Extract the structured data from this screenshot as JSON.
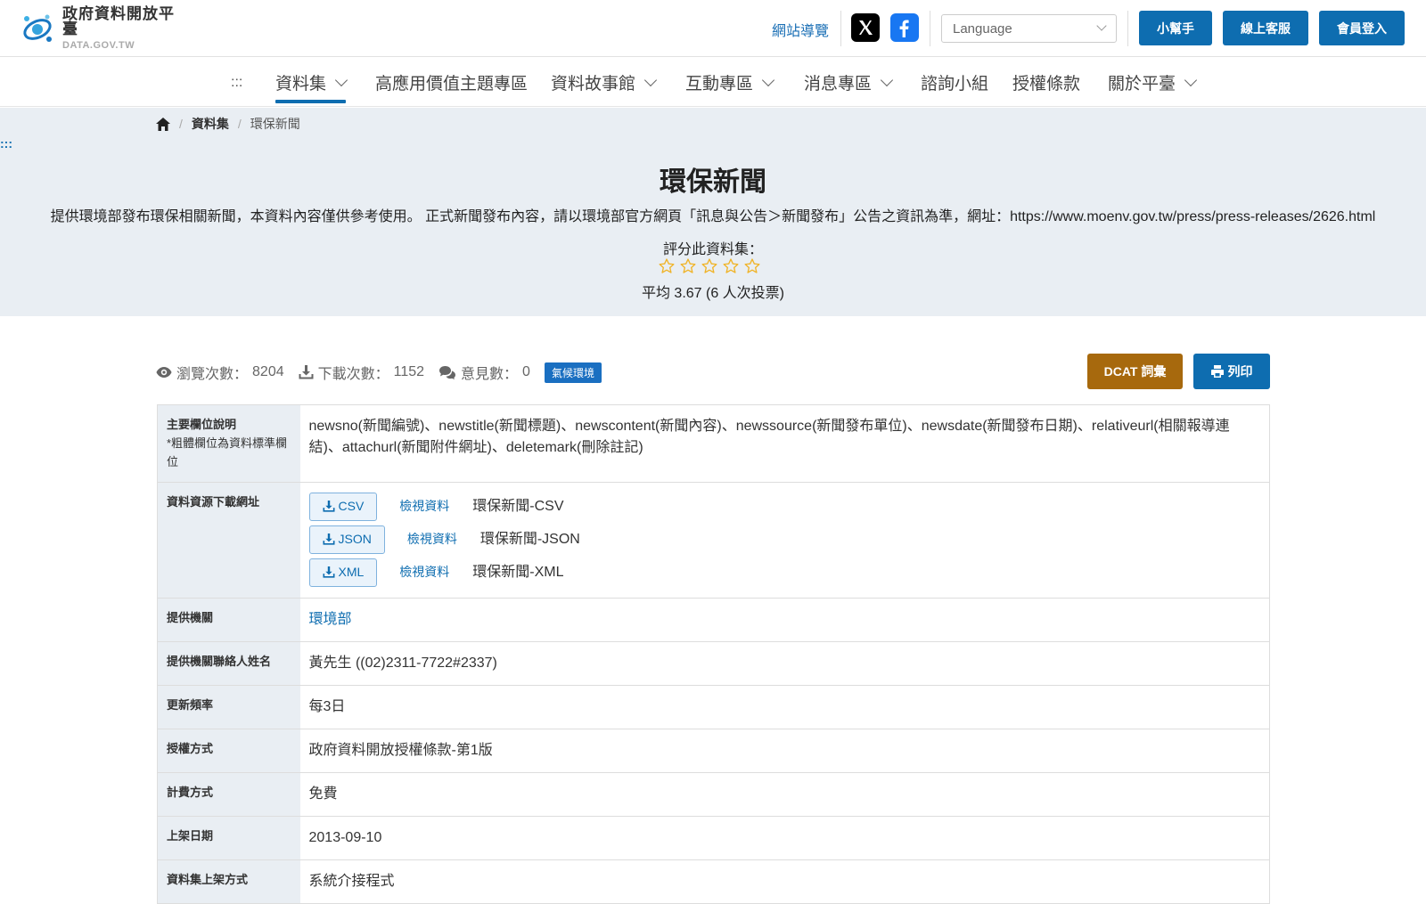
{
  "header": {
    "logo_title": "政府資料開放平臺",
    "logo_sub": "DATA.GOV.TW",
    "sitemap": "網站導覽",
    "language_placeholder": "Language",
    "buttons": {
      "helper": "小幫手",
      "support": "線上客服",
      "login": "會員登入"
    }
  },
  "nav": {
    "accesskey": ":::",
    "items": [
      {
        "label": "資料集"
      },
      {
        "label": "高應用價值主題專區"
      },
      {
        "label": "資料故事館"
      },
      {
        "label": "互動專區"
      },
      {
        "label": "消息專區"
      },
      {
        "label": "諮詢小組"
      },
      {
        "label": "授權條款"
      },
      {
        "label": "關於平臺"
      }
    ]
  },
  "breadcrumb": {
    "level1": "資料集",
    "level2": "環保新聞"
  },
  "hero": {
    "accesskey": ":::",
    "title": "環保新聞",
    "description": "提供環境部發布環保相關新聞，本資料內容僅供參考使用。 正式新聞發布內容，請以環境部官方網頁「訊息與公告＞新聞發布」公告之資訊為準，網址：https://www.moenv.gov.tw/press/press-releases/2626.html",
    "rate_label": "評分此資料集：",
    "average": "平均 3.67 (6 人次投票)"
  },
  "stats": {
    "views_label": "瀏覽次數：",
    "views": "8204",
    "downloads_label": "下載次數：",
    "downloads": "1152",
    "comments_label": "意見數：",
    "comments": "0",
    "tag": "氣候環境",
    "dcat": "DCAT 詞彙",
    "print": "列印"
  },
  "table": {
    "fields_label": "主要欄位說明",
    "fields_note": "*粗體欄位為資料標準欄位",
    "fields_value": "newsno(新聞編號)、newstitle(新聞標題)、newscontent(新聞內容)、newssource(新聞發布單位)、newsdate(新聞發布日期)、relativeurl(相關報導連結)、attachurl(新聞附件網址)、deletemark(刪除註記)",
    "resources_label": "資料資源下載網址",
    "view_label": "檢視資料",
    "resources": [
      {
        "format": "CSV",
        "name": "環保新聞-CSV"
      },
      {
        "format": "JSON",
        "name": "環保新聞-JSON"
      },
      {
        "format": "XML",
        "name": "環保新聞-XML"
      }
    ],
    "org_label": "提供機關",
    "org_value": "環境部",
    "contact_label": "提供機關聯絡人姓名",
    "contact_value": "黃先生 ((02)2311-7722#2337)",
    "freq_label": "更新頻率",
    "freq_value": "每3日",
    "license_label": "授權方式",
    "license_value": "政府資料開放授權條款-第1版",
    "fee_label": "計費方式",
    "fee_value": "免費",
    "date_label": "上架日期",
    "date_value": "2013-09-10",
    "method_label": "資料集上架方式",
    "method_value": "系統介接程式"
  },
  "colors": {
    "primary": "#0e6db0",
    "dcat": "#a7690d",
    "hero_bg": "#e9eef3",
    "star": "#f0b429"
  }
}
